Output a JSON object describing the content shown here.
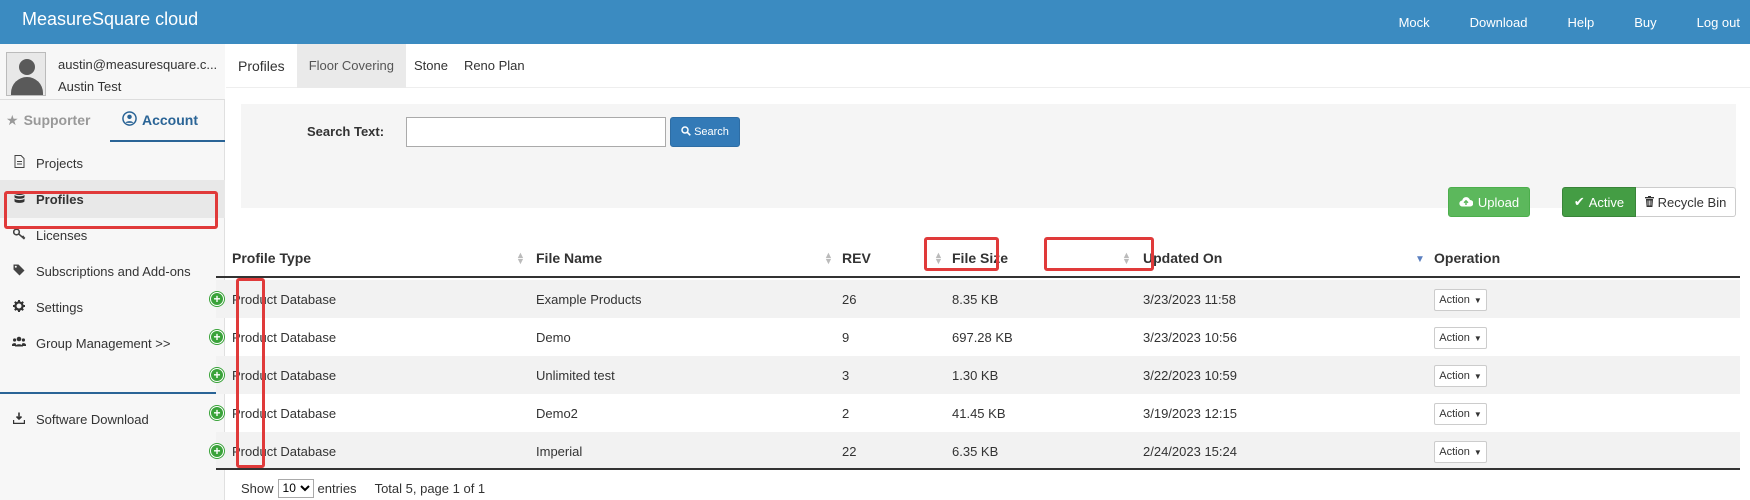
{
  "header": {
    "brand": "MeasureSquare cloud",
    "nav": [
      "Mock",
      "Download",
      "Help",
      "Buy",
      "Log out"
    ]
  },
  "user": {
    "email": "austin@measuresquare.c...",
    "name": "Austin Test"
  },
  "side_tabs": {
    "supporter": "Supporter",
    "account": "Account"
  },
  "menu": {
    "projects": "Projects",
    "profiles": "Profiles",
    "licenses": "Licenses",
    "subscriptions": "Subscriptions and Add-ons",
    "settings": "Settings",
    "group_management": "Group Management >>",
    "software_download": "Software Download"
  },
  "sub_tabs": [
    "Profiles",
    "Floor Covering",
    "Stone",
    "Reno Plan"
  ],
  "search": {
    "label": "Search Text:",
    "value": "",
    "button": "Search"
  },
  "toolbar": {
    "upload": "Upload",
    "active": "Active",
    "recycle_bin": "Recycle Bin"
  },
  "table": {
    "columns": [
      "Profile Type",
      "File Name",
      "REV",
      "File Size",
      "Updated On",
      "Operation"
    ],
    "rows": [
      {
        "type": "Product Database",
        "file": "Example Products",
        "rev": "26",
        "size": "8.35 KB",
        "updated": "3/23/2023 11:58",
        "op": "Action"
      },
      {
        "type": "Product Database",
        "file": "Demo",
        "rev": "9",
        "size": "697.28 KB",
        "updated": "3/23/2023 10:56",
        "op": "Action"
      },
      {
        "type": "Product Database",
        "file": "Unlimited test",
        "rev": "3",
        "size": "1.30 KB",
        "updated": "3/22/2023 10:59",
        "op": "Action"
      },
      {
        "type": "Product Database",
        "file": "Demo2",
        "rev": "2",
        "size": "41.45 KB",
        "updated": "3/19/2023 12:15",
        "op": "Action"
      },
      {
        "type": "Product Database",
        "file": "Imperial",
        "rev": "22",
        "size": "6.35 KB",
        "updated": "2/24/2023 15:24",
        "op": "Action"
      }
    ]
  },
  "footer": {
    "show": "Show",
    "page_size": "10",
    "entries": "entries",
    "total": "Total 5, page 1 of 1"
  },
  "colors": {
    "header_bg": "#3b8bc1",
    "primary": "#337ab7",
    "success": "#5cb85c",
    "highlight": "#e03a3a"
  }
}
